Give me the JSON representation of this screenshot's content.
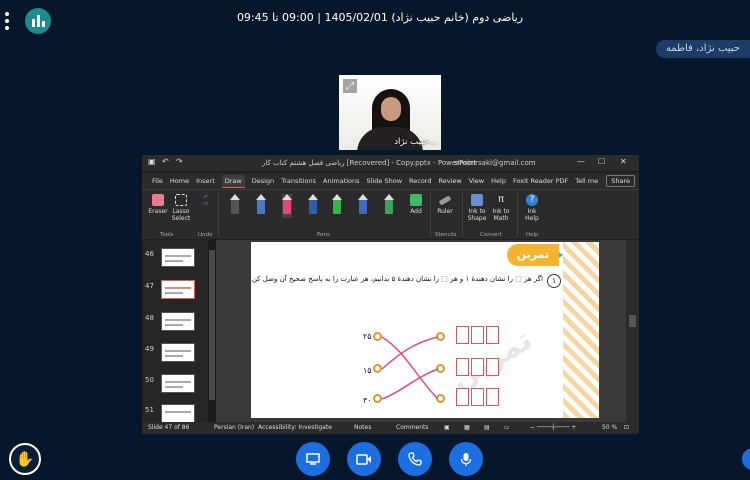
{
  "meeting": {
    "title": "ریاضی دوم (خانم حبیب نژاد) 1405/02/01 | 09:00 تا 09:45",
    "presenter_tag": "حبیب نژاد، فاطمه",
    "webcam_name": "حبیب نژاد..."
  },
  "ppt": {
    "window_title": "رياضی فصل هشتم کتاب کار [Recovered] - Copy.pptx - PowerPoint",
    "account_email": "simonrsaki@gmail.com",
    "menu": [
      "File",
      "Home",
      "Insert",
      "Draw",
      "Design",
      "Transitions",
      "Animations",
      "Slide Show",
      "Record",
      "Review",
      "View",
      "Help",
      "Foxit Reader PDF"
    ],
    "tell_me": "Tell me",
    "share": "Share",
    "ribbon": {
      "eraser": "Eraser",
      "lasso": "Lasso Select",
      "add": "Add",
      "ruler": "Ruler",
      "ink_to_shape": "Ink to Shape",
      "ink_to_math": "Ink to Math",
      "ink_help": "Ink Help",
      "groups": {
        "tools": "Tools",
        "undo": "Undo",
        "pens": "Pens",
        "stencils": "Stencils",
        "convert": "Convert",
        "help": "Help"
      }
    },
    "slide_thumbs": [
      "46",
      "47",
      "48",
      "49",
      "50",
      "51"
    ],
    "slide": {
      "badge": "تمرین",
      "question_number": "۱",
      "question_text": "اگر هر ⬚ را نشان دهندهٔ ۱ و هر ⬚ را نشان دهندهٔ ۵ بدانیم، هر عبارت را به پاسخ صحیح آن وصل کن.",
      "left_numbers": [
        "۲۵",
        "۱۵",
        "۳۰"
      ]
    },
    "status": {
      "slide_count": "Slide 47 of 86",
      "language": "Persian (Iran)",
      "accessibility": "Accessibility: Investigate",
      "notes": "Notes",
      "comments": "Comments",
      "zoom": "50 %"
    }
  },
  "colors": {
    "background": "#06172b",
    "accent": "#1b6fe0",
    "ppt_accent": "#e35d4b"
  },
  "icons": [
    "menu-dots-icon",
    "stats-icon",
    "fullscreen-icon",
    "raise-hand-icon",
    "screen-share-icon",
    "camera-icon",
    "phone-icon",
    "microphone-icon"
  ]
}
